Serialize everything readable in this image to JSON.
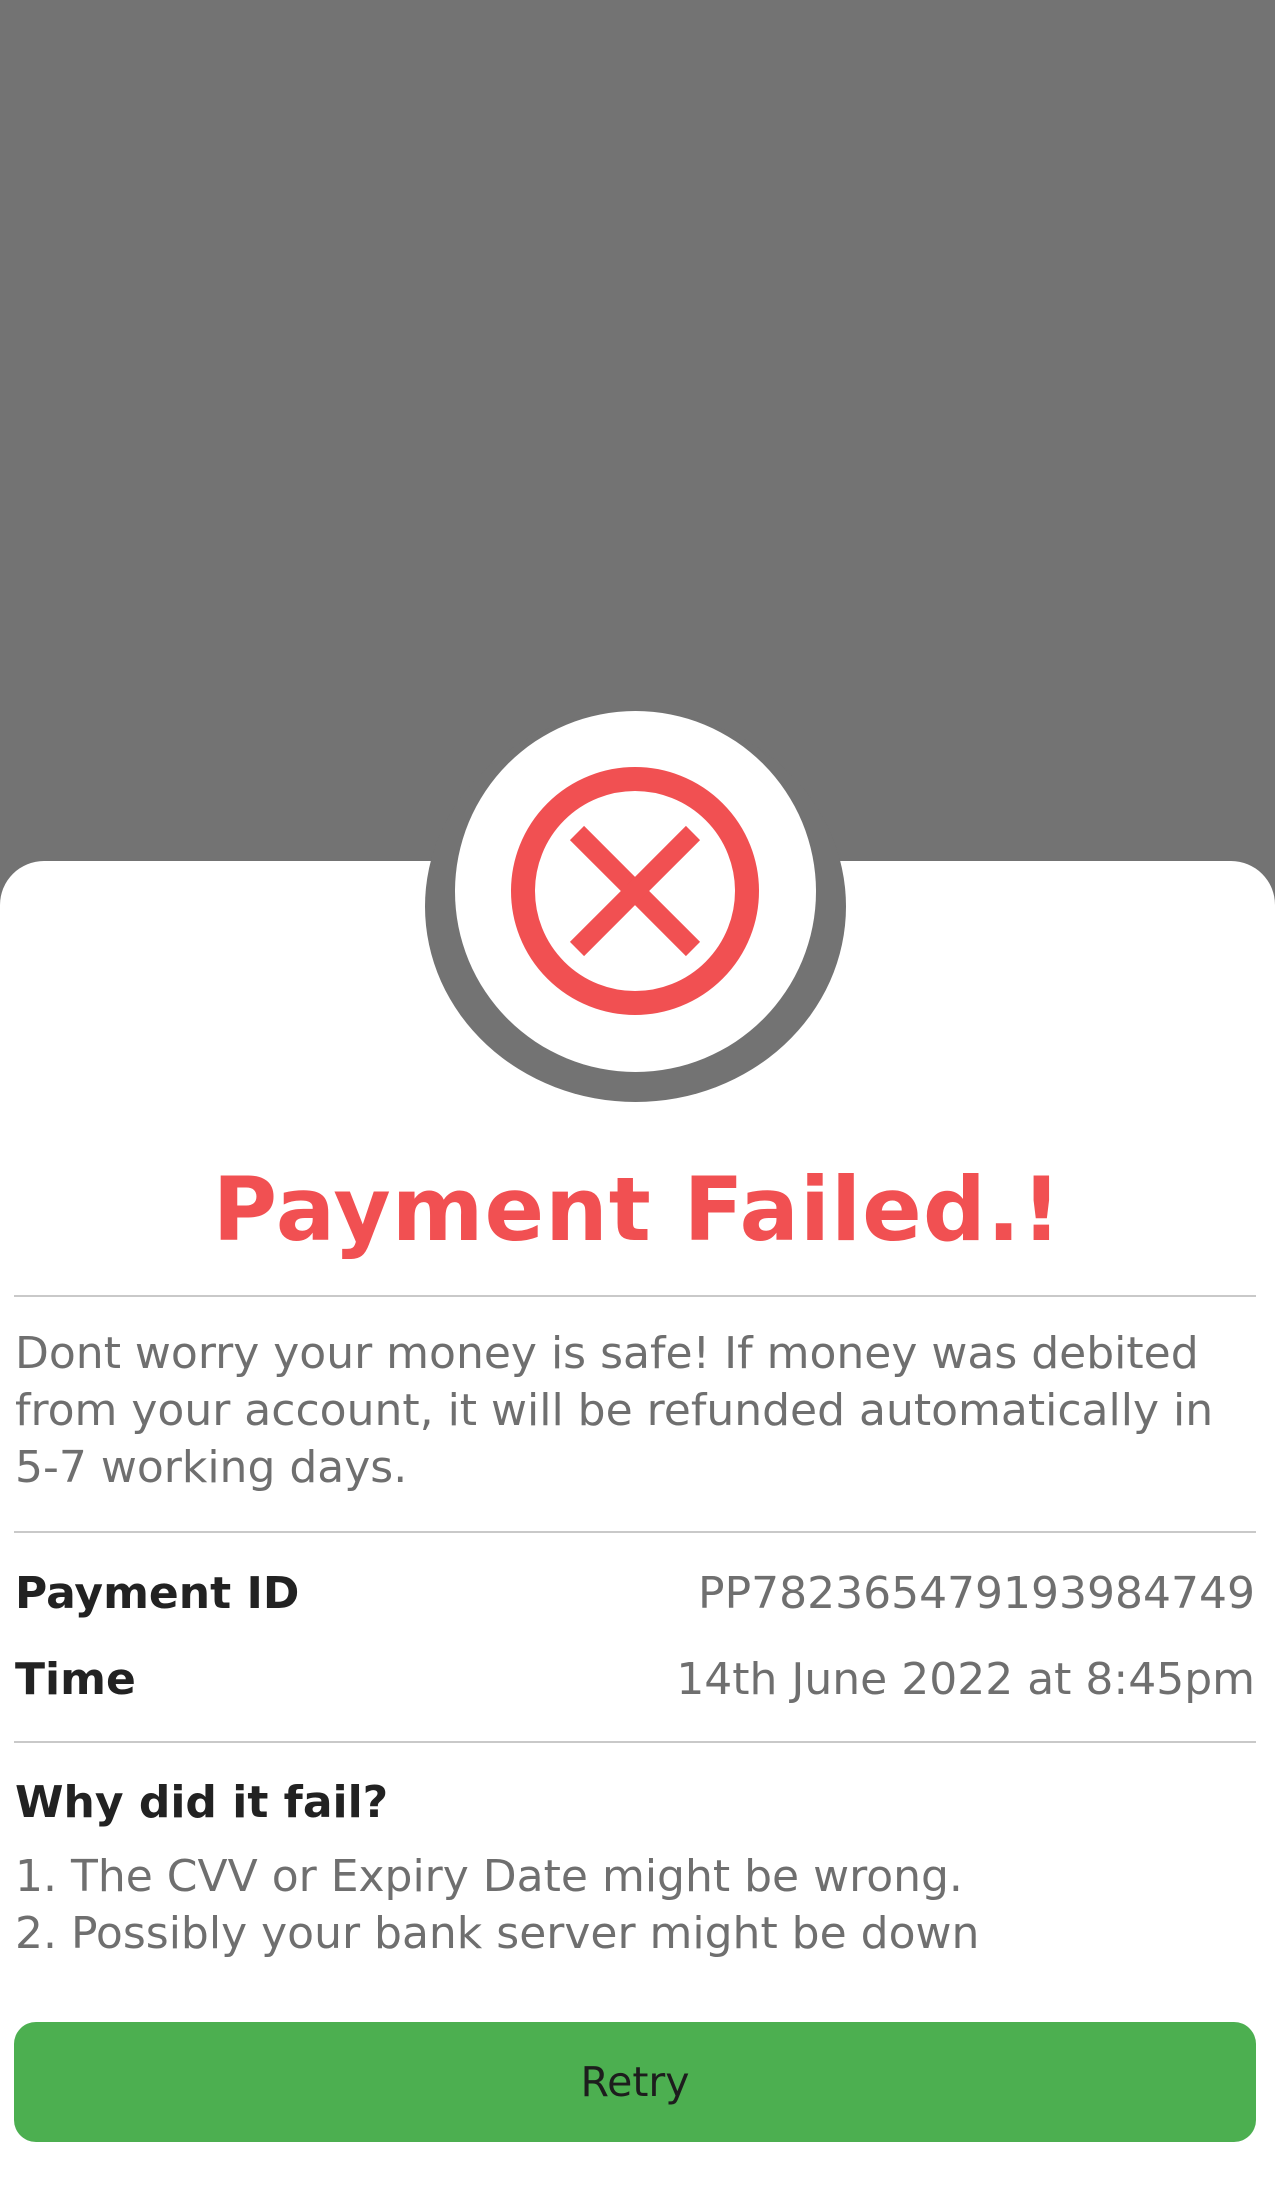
{
  "status": {
    "title": "Payment Failed.!",
    "icon": "error-x-circle-icon",
    "accent_color": "#f15052"
  },
  "message": "Dont worry your money is safe! If money was debited from your account, it will be refunded automatically in 5-7 working days.",
  "details": [
    {
      "label": "Payment ID",
      "value": "PP782365479193984749"
    },
    {
      "label": "Time",
      "value": "14th June 2022 at 8:45pm"
    }
  ],
  "failure_reasons": {
    "heading": "Why did it fail?",
    "items": [
      "1. The CVV or Expiry Date might be wrong.",
      "2. Possibly your bank server might be down"
    ]
  },
  "actions": {
    "retry_label": "Retry",
    "button_color": "#4caf50"
  }
}
